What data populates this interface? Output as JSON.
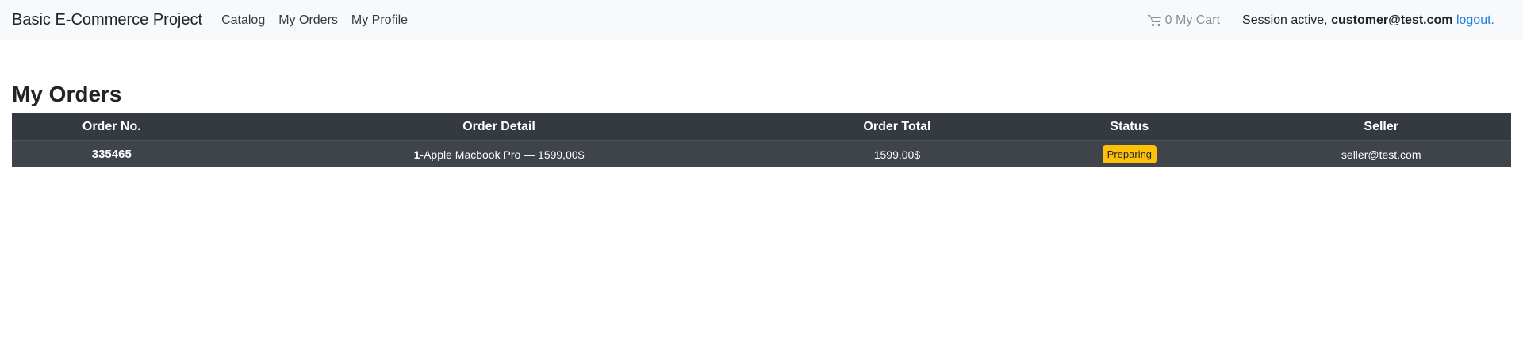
{
  "navbar": {
    "brand": "Basic E-Commerce Project",
    "links": [
      "Catalog",
      "My Orders",
      "My Profile"
    ],
    "cart": {
      "count": "0",
      "label": "My Cart",
      "icon": "cart-icon"
    },
    "session": {
      "prefix": "Session active,",
      "email": "customer@test.com",
      "logout": "logout."
    }
  },
  "page": {
    "title": "My Orders"
  },
  "orders_table": {
    "headers": [
      "Order No.",
      "Order Detail",
      "Order Total",
      "Status",
      "Seller"
    ],
    "rows": [
      {
        "order_no": "335465",
        "detail_qty": "1",
        "detail_text": "-Apple Macbook Pro — 1599,00$",
        "total": "1599,00$",
        "status": "Preparing",
        "seller": "seller@test.com"
      }
    ]
  },
  "colors": {
    "navbar_bg": "#f8f9fa",
    "table_header_bg": "#343a40",
    "table_row_bg": "#3e444a",
    "status_preparing": "#ffc107",
    "link_blue": "#1a7fe5"
  }
}
